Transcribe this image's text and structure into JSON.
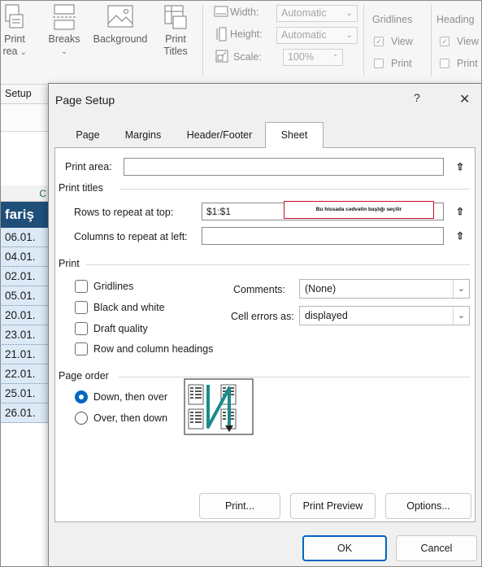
{
  "ribbon": {
    "print_area_label": "Print",
    "print_area_sub": "rea",
    "breaks_label": "Breaks",
    "background_label": "Background",
    "print_titles_label_1": "Print",
    "print_titles_label_2": "Titles",
    "width_label": "Width:",
    "width_value": "Automatic",
    "height_label": "Height:",
    "height_value": "Automatic",
    "scale_label": "Scale:",
    "scale_value": "100%",
    "gridlines_label": "Gridlines",
    "gridlines_view": "View",
    "gridlines_print": "Print",
    "headings_label": "Heading",
    "headings_view": "View",
    "headings_print": "Print",
    "group_label": "Setup"
  },
  "sheet": {
    "column_letter": "C",
    "header_cell": "fariş",
    "rows": [
      "06.01.",
      "04.01.",
      "02.01.",
      "05.01.",
      "20.01.",
      "23.01.",
      "21.01.",
      "22.01.",
      "25.01.",
      "26.01."
    ]
  },
  "dialog": {
    "title": "Page Setup",
    "help": "?",
    "close": "✕",
    "tabs": [
      {
        "label": "Page",
        "active": false
      },
      {
        "label": "Margins",
        "active": false
      },
      {
        "label": "Header/Footer",
        "active": false
      },
      {
        "label": "Sheet",
        "active": true
      }
    ],
    "print_area_label": "Print area:",
    "print_area_value": "",
    "print_titles_section": "Print titles",
    "rows_repeat_label": "Rows to repeat at top:",
    "rows_repeat_value": "$1:$1",
    "cols_repeat_label": "Columns to repeat at left:",
    "cols_repeat_value": "",
    "annotation": "Bu hissada cədvəlin başlığı seçilir",
    "print_section": "Print",
    "gridlines_label": "Gridlines",
    "black_white_label": "Black and white",
    "draft_quality_label": "Draft quality",
    "row_col_headings_label": "Row and column headings",
    "comments_label": "Comments:",
    "comments_value": "(None)",
    "cell_errors_label": "Cell errors as:",
    "cell_errors_value": "displayed",
    "page_order_section": "Page order",
    "down_then_over_label": "Down, then over",
    "over_then_down_label": "Over, then down",
    "page_order_selected": "Down, then over",
    "print_button": "Print...",
    "print_preview_button": "Print Preview",
    "options_button": "Options...",
    "ok_button": "OK",
    "cancel_button": "Cancel"
  },
  "colors": {
    "accent": "#0067c0",
    "annotation_border": "#c8102e",
    "header_fill": "#1f4e79",
    "data_fill": "#dce9f6",
    "column_letter": "#217346"
  }
}
